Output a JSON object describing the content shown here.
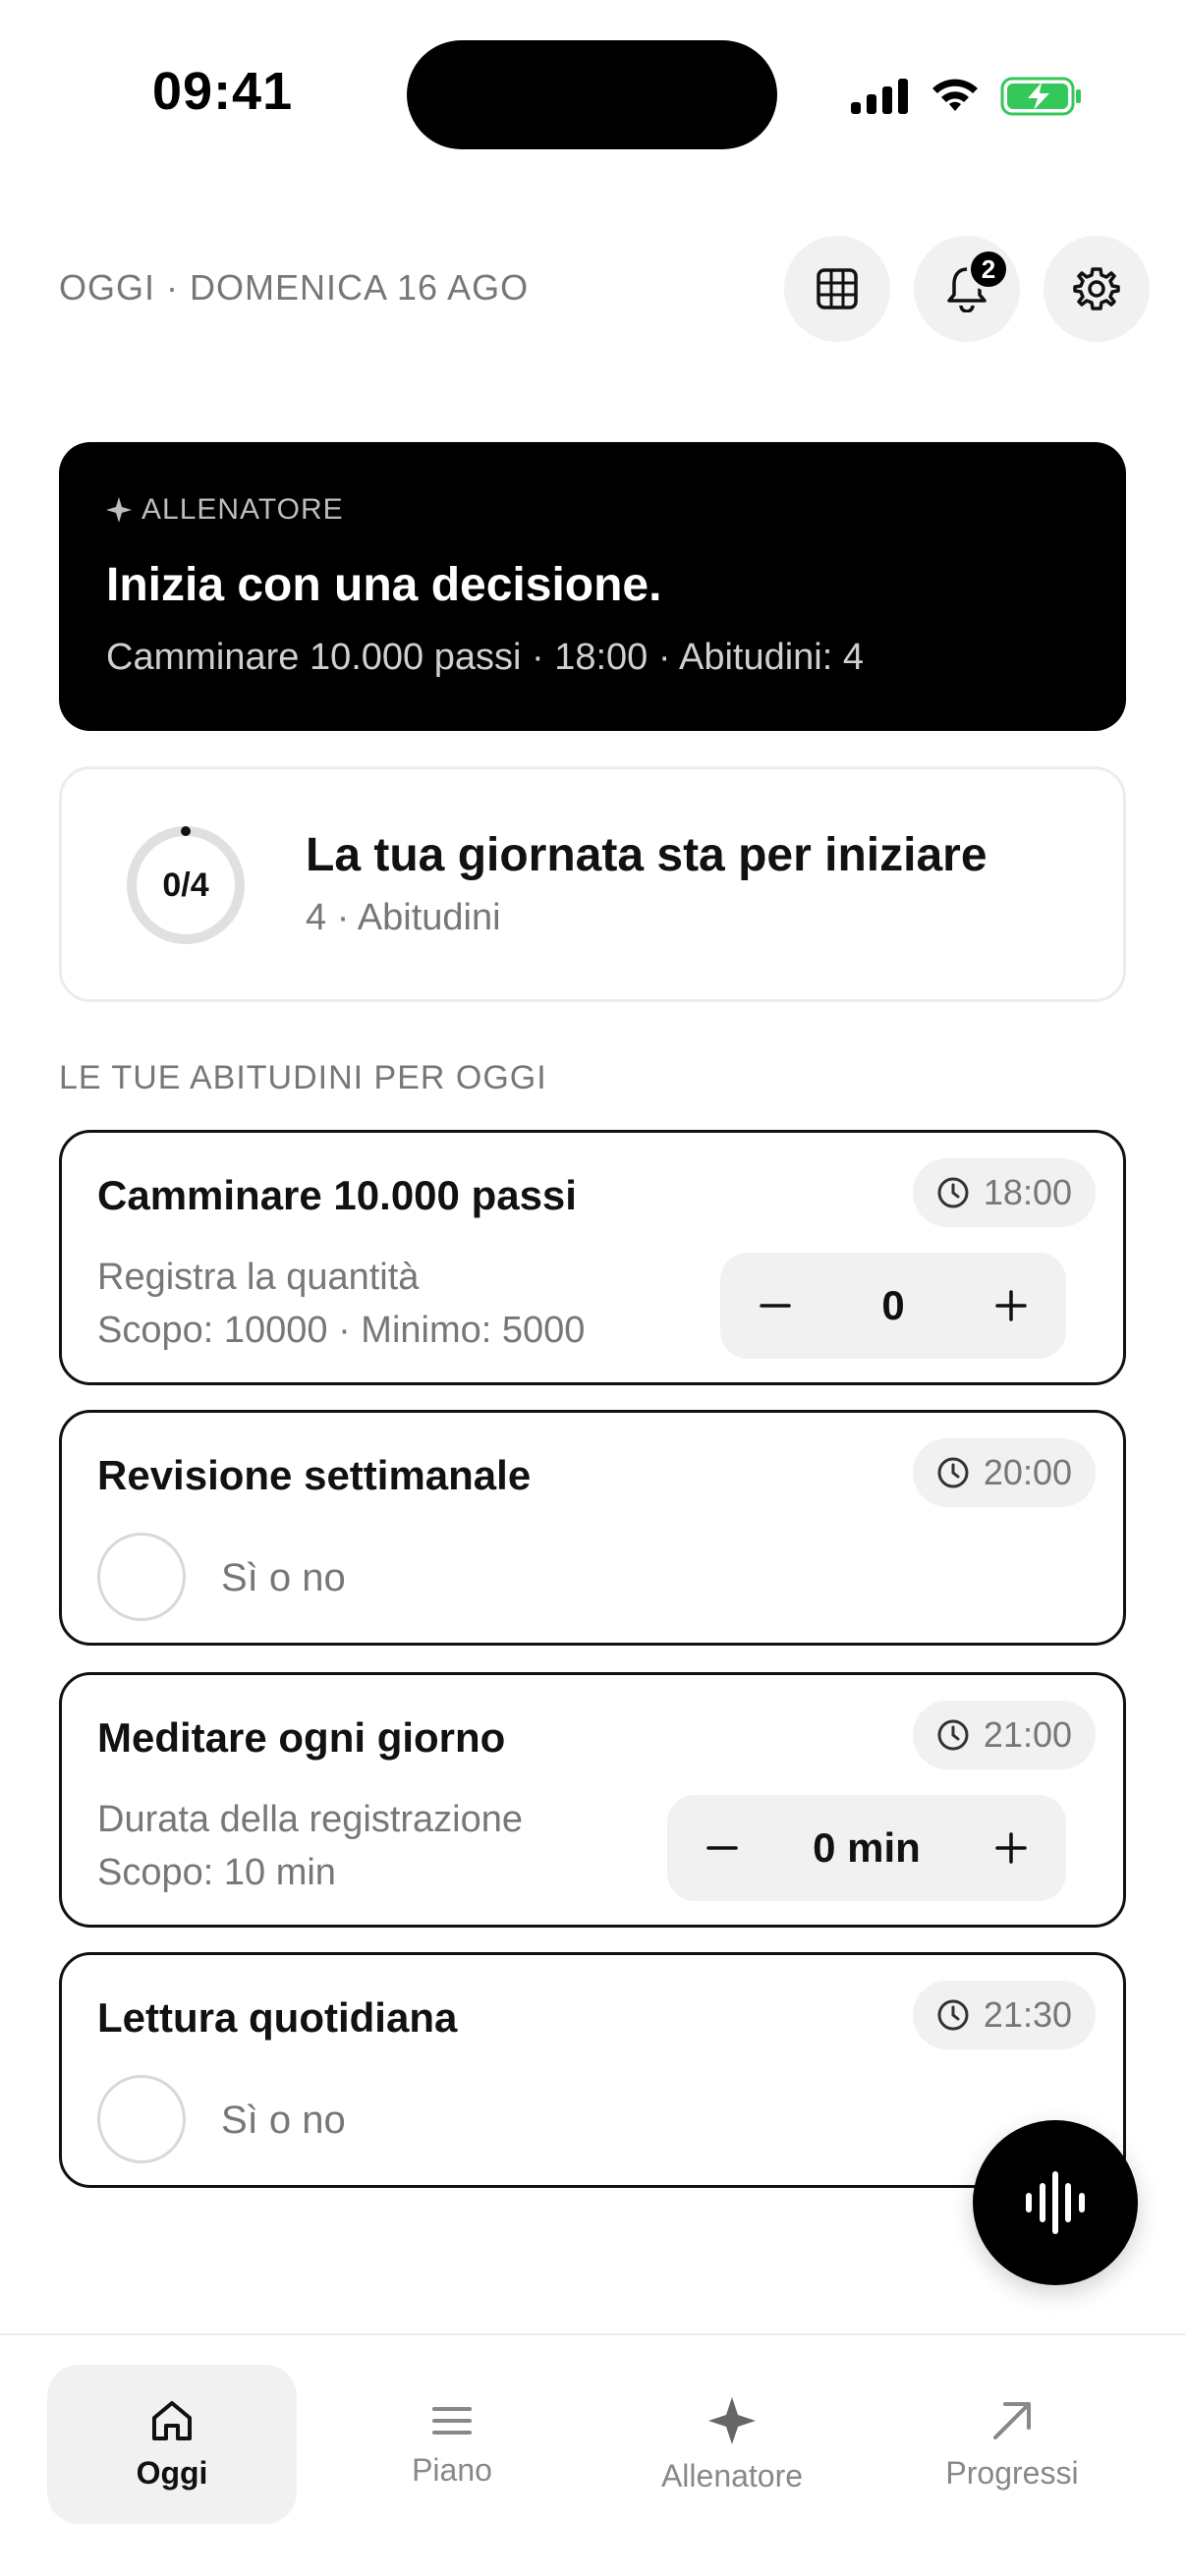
{
  "status_bar": {
    "time": "09:41",
    "icons": [
      "cellular-signal-icon",
      "wifi-icon",
      "battery-charging-icon"
    ]
  },
  "header": {
    "date": "OGGI · DOMENICA 16 AGO",
    "buttons": [
      "calendar-grid-icon",
      "bell-icon",
      "gear-icon"
    ],
    "notification_count": "2"
  },
  "coach": {
    "label": "ALLENATORE",
    "title": "Inizia con una decisione.",
    "subtitle": "Camminare 10.000 passi · 18:00 · Abitudini: 4"
  },
  "progress": {
    "ring_text": "0/4",
    "completed": 0,
    "total": 4,
    "title": "La tua giornata sta per iniziare",
    "subtitle": "4 · Abitudini"
  },
  "section_title": "LE TUE ABITUDINI PER OGGI",
  "habits": [
    {
      "title": "Camminare 10.000 passi",
      "time": "18:00",
      "desc_line1": "Registra la quantità",
      "desc_line2": "Scopo: 10000 · Minimo: 5000",
      "value": "0"
    },
    {
      "title": "Revisione settimanale",
      "time": "20:00",
      "check_label": "Sì o no"
    },
    {
      "title": "Meditare ogni giorno",
      "time": "21:00",
      "desc_line1": "Durata della registrazione",
      "desc_line2": "Scopo: 10 min",
      "value": "0 min"
    },
    {
      "title": "Lettura quotidiana",
      "time": "21:30",
      "check_label": "Sì o no"
    }
  ],
  "colors": {
    "accent": "#000000",
    "muted_text": "#777777",
    "pill_bg": "#f1f1f1",
    "battery": "#34c759"
  },
  "nav": [
    {
      "label": "Oggi",
      "icon": "home-icon",
      "active": true
    },
    {
      "label": "Piano",
      "icon": "menu-lines-icon",
      "active": false
    },
    {
      "label": "Allenatore",
      "icon": "sparkle-icon",
      "active": false
    },
    {
      "label": "Progressi",
      "icon": "arrow-up-right-icon",
      "active": false
    }
  ]
}
